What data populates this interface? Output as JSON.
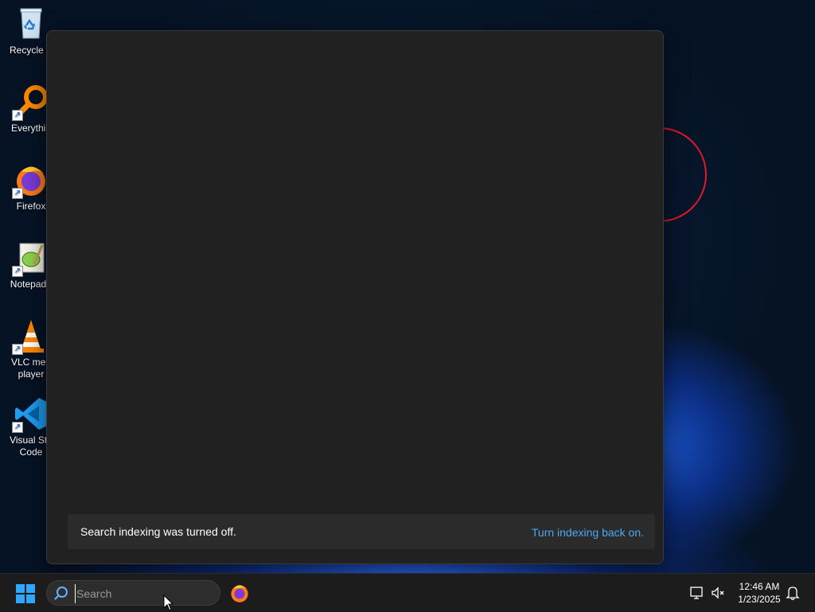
{
  "desktop": {
    "icons": [
      {
        "label": "Recycle B",
        "icon": "recycle-bin-icon"
      },
      {
        "label": "Everythin",
        "icon": "everything-search-icon"
      },
      {
        "label": "Firefox",
        "icon": "firefox-icon"
      },
      {
        "label": "Notepad+",
        "icon": "notepad-plus-plus-icon"
      },
      {
        "label": "VLC med player",
        "icon": "vlc-icon"
      },
      {
        "label": "Visual Stu Code",
        "icon": "vscode-icon"
      }
    ]
  },
  "search_flyout": {
    "notice_text": "Search indexing was turned off.",
    "notice_link": "Turn indexing back on."
  },
  "taskbar": {
    "search_placeholder": "Search",
    "search_value": "",
    "clock_time": "12:46 AM",
    "clock_date": "1/23/2025",
    "pinned": [
      "firefox-icon"
    ],
    "tray": [
      "network-display-icon",
      "speaker-muted-icon",
      "notification-bell-icon"
    ]
  },
  "colors": {
    "taskbar_bg": "#1c1c1c",
    "flyout_bg": "#212121",
    "link": "#4aa8f2",
    "windows_blue": "#1e90ff"
  }
}
